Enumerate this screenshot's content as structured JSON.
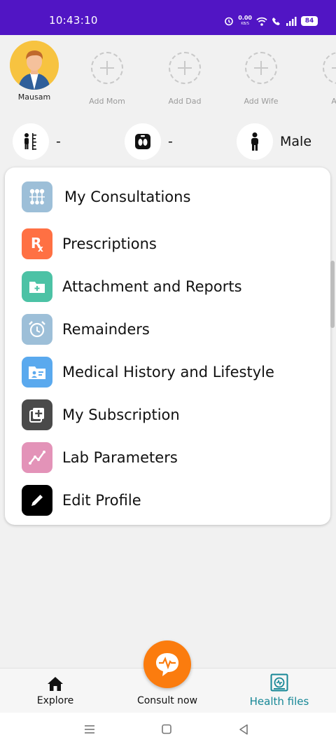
{
  "status_bar": {
    "time": "10:43:10",
    "net_speed_value": "0.00",
    "net_speed_unit": "KB/S",
    "battery": "84",
    "icons": [
      "alarm-icon",
      "wifi-icon",
      "wifi-call-icon",
      "signal-icon",
      "battery-icon"
    ]
  },
  "members": [
    {
      "label": "Mausam",
      "type": "avatar"
    },
    {
      "label": "Add Mom",
      "type": "add"
    },
    {
      "label": "Add Dad",
      "type": "add"
    },
    {
      "label": "Add Wife",
      "type": "add"
    },
    {
      "label": "Add",
      "type": "add"
    }
  ],
  "stats": {
    "height": {
      "icon": "height-icon",
      "value": "-"
    },
    "weight": {
      "icon": "weight-scale-icon",
      "value": "-"
    },
    "gender": {
      "icon": "person-icon",
      "value": "Male"
    }
  },
  "menu": [
    {
      "label": "My Consultations",
      "icon": "consultations-icon",
      "color": "#9dbfd8"
    },
    {
      "label": "Prescriptions",
      "icon": "rx-icon",
      "color": "#ff7043"
    },
    {
      "label": "Attachment and Reports",
      "icon": "folder-plus-icon",
      "color": "#4cc2a5"
    },
    {
      "label": "Remainders",
      "icon": "alarm-clock-icon",
      "color": "#9dbfd8"
    },
    {
      "label": "Medical History and Lifestyle",
      "icon": "medical-folder-icon",
      "color": "#5aa9ee"
    },
    {
      "label": "My Subscription",
      "icon": "subscription-icon",
      "color": "#4a4a4a"
    },
    {
      "label": "Lab Parameters",
      "icon": "chart-line-icon",
      "color": "#e393b8"
    },
    {
      "label": "Edit Profile",
      "icon": "pencil-icon",
      "color": "#000000"
    }
  ],
  "bottom_nav": {
    "explore": "Explore",
    "consult": "Consult now",
    "health_files": "Health files",
    "active_color": "#168796",
    "consult_color": "#fb7c0e"
  },
  "colors": {
    "status_bar": "#5115c4",
    "background": "#f1f1f1"
  }
}
